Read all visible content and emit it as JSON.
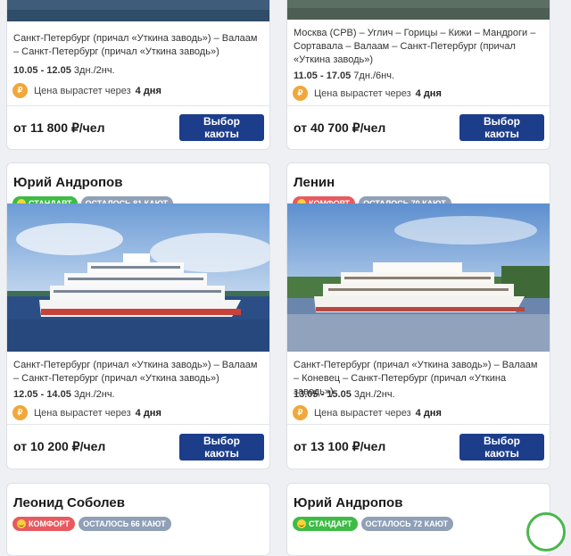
{
  "cards": [
    {
      "route": "Санкт-Петербург (причал «Уткина заводь») – Валаам – Санкт-Петербург (причал «Уткина заводь»)",
      "dates": "10.05 - 12.05",
      "duration": "3дн./2нч.",
      "price_note": "Цена вырастет через",
      "price_days": "4 дня",
      "price": "от 11 800 ₽/чел",
      "button": "Выбор каюты"
    },
    {
      "route": "Москва (СРВ) – Углич – Горицы – Кижи – Мандроги – Сортавала – Валаам – Санкт-Петербург (причал «Уткина заводь»)",
      "dates": "11.05 - 17.05",
      "duration": "7дн./6нч.",
      "price_note": "Цена вырастет через",
      "price_days": "4 дня",
      "price": "от 40 700 ₽/чел",
      "button": "Выбор каюты"
    },
    {
      "title": "Юрий Андропов",
      "class_badge": "Стандарт",
      "cabins_badge": "Осталось 81 кают",
      "route": "Санкт-Петербург (причал «Уткина заводь») – Валаам – Санкт-Петербург (причал «Уткина заводь»)",
      "dates": "12.05 - 14.05",
      "duration": "3дн./2нч.",
      "price_note": "Цена вырастет через",
      "price_days": "4 дня",
      "price": "от 10 200 ₽/чел",
      "button": "Выбор каюты"
    },
    {
      "title": "Ленин",
      "class_badge": "Комфорт",
      "cabins_badge": "Осталось 70 кают",
      "route": "Санкт-Петербург (причал «Уткина заводь») – Валаам – Коневец – Санкт-Петербург (причал «Уткина заводь»)",
      "dates": "13.05 - 15.05",
      "duration": "3дн./2нч.",
      "price_note": "Цена вырастет через",
      "price_days": "4 дня",
      "price": "от 13 100 ₽/чел",
      "button": "Выбор каюты"
    },
    {
      "title": "Леонид Соболев",
      "class_badge": "Комфорт",
      "cabins_badge": "Осталось 66 кают"
    },
    {
      "title": "Юрий Андропов",
      "class_badge": "Стандарт",
      "cabins_badge": "Осталось 72 кают"
    }
  ],
  "colors": {
    "button": "#1c3d8a",
    "standard_badge": "#3dbb45",
    "comfort_badge": "#e85a5f",
    "cabins_badge": "#8fa0b7",
    "ruble_icon": "#f0a73b"
  },
  "icons": {
    "ruble": "₽"
  }
}
